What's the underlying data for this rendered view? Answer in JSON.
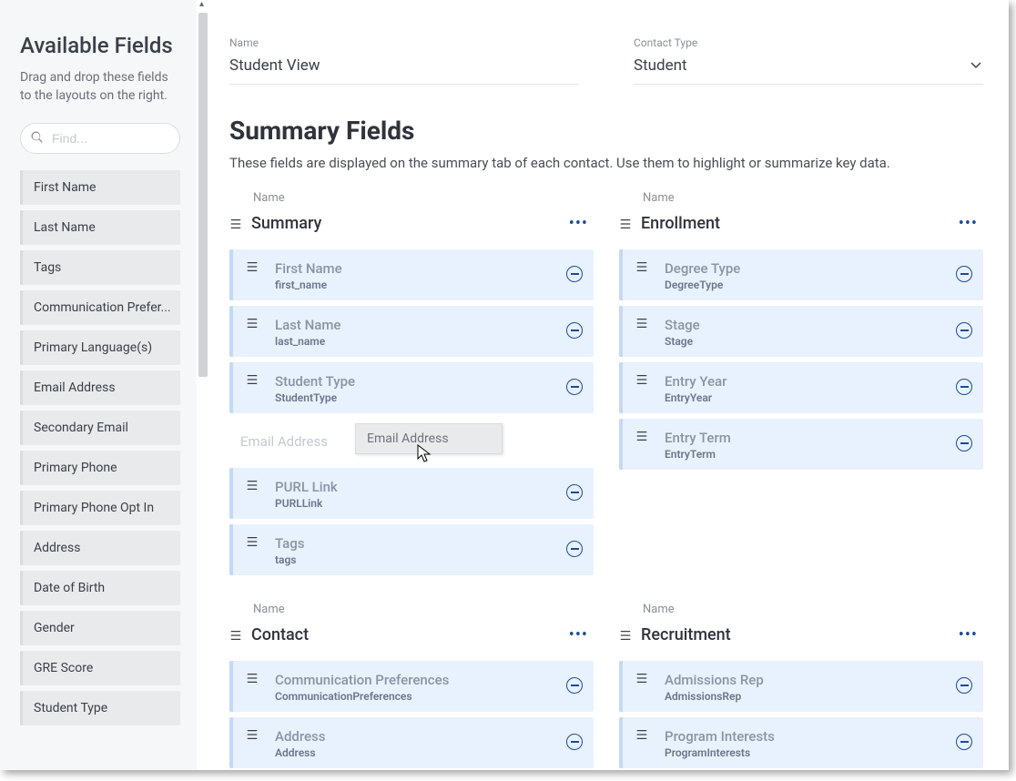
{
  "sidebar": {
    "title": "Available Fields",
    "description": "Drag and drop these fields to the layouts on the right.",
    "search_placeholder": "Find...",
    "items": [
      "First Name",
      "Last Name",
      "Tags",
      "Communication Prefer...",
      "Primary Language(s)",
      "Email Address",
      "Secondary Email",
      "Primary Phone",
      "Primary Phone Opt In",
      "Address",
      "Date of Birth",
      "Gender",
      "GRE Score",
      "Student Type"
    ]
  },
  "header": {
    "name_label": "Name",
    "name_value": "Student View",
    "contact_type_label": "Contact Type",
    "contact_type_value": "Student"
  },
  "summary_section": {
    "title": "Summary Fields",
    "description": "These fields are displayed on the summary tab of each contact. Use them to highlight or summarize key data.",
    "name_col_label": "Name"
  },
  "groups": {
    "summary": {
      "title": "Summary",
      "cards": [
        {
          "title": "First Name",
          "sub": "first_name"
        },
        {
          "title": "Last Name",
          "sub": "last_name"
        },
        {
          "title": "Student Type",
          "sub": "StudentType"
        }
      ],
      "placeholder": "Email Address",
      "cards_after": [
        {
          "title": "PURL Link",
          "sub": "PURLLink"
        },
        {
          "title": "Tags",
          "sub": "tags"
        }
      ]
    },
    "enrollment": {
      "title": "Enrollment",
      "cards": [
        {
          "title": "Degree Type",
          "sub": "DegreeType"
        },
        {
          "title": "Stage",
          "sub": "Stage"
        },
        {
          "title": "Entry Year",
          "sub": "EntryYear"
        },
        {
          "title": "Entry Term",
          "sub": "EntryTerm"
        }
      ]
    },
    "contact": {
      "title": "Contact",
      "cards": [
        {
          "title": "Communication Preferences",
          "sub": "CommunicationPreferences"
        },
        {
          "title": "Address",
          "sub": "Address"
        }
      ]
    },
    "recruitment": {
      "title": "Recruitment",
      "cards": [
        {
          "title": "Admissions Rep",
          "sub": "AdmissionsRep"
        },
        {
          "title": "Program Interests",
          "sub": "ProgramInterests"
        }
      ]
    }
  },
  "drag_ghost": "Email Address"
}
